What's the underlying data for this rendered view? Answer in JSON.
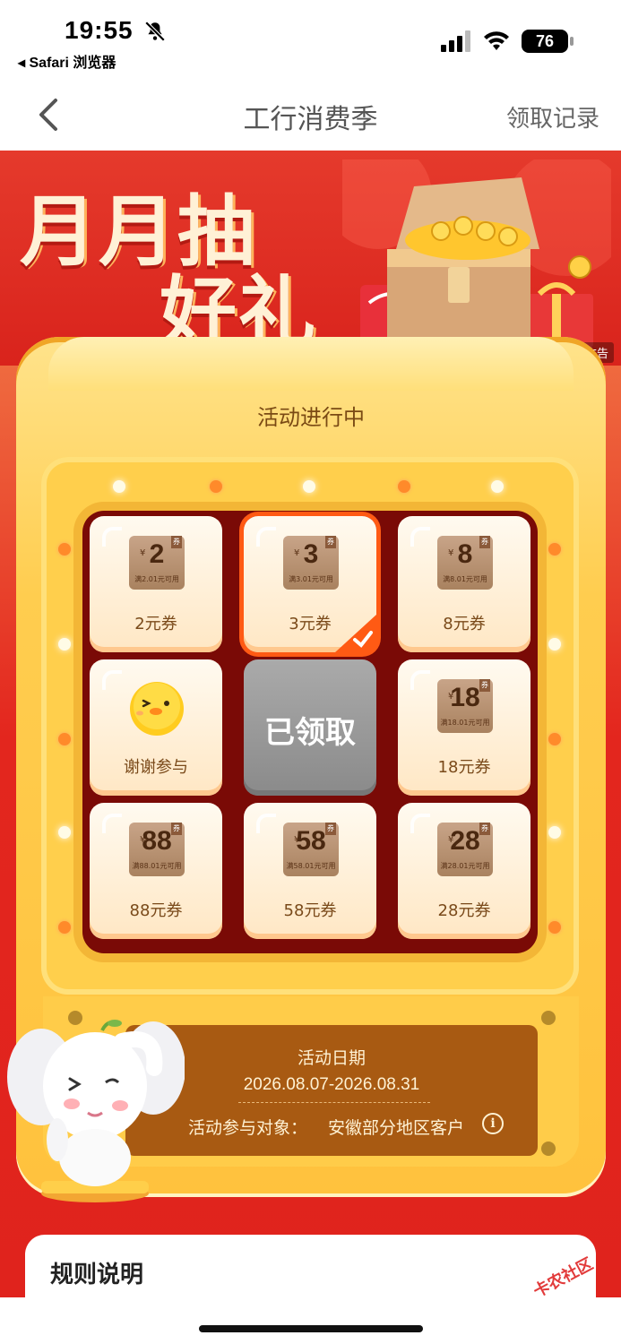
{
  "status_bar": {
    "time": "19:55",
    "back_app": "◂ Safari 浏览器",
    "battery": "76"
  },
  "nav": {
    "title": "工行消费季",
    "right_link": "领取记录"
  },
  "banner": {
    "line1": "月月抽",
    "line2": "好礼",
    "ad_tag": "广告"
  },
  "activity": {
    "status": "活动进行中"
  },
  "grid": {
    "cells": [
      {
        "amount": "2",
        "condition": "满2.01元可用",
        "label": "2元券"
      },
      {
        "amount": "3",
        "condition": "满3.01元可用",
        "label": "3元券"
      },
      {
        "amount": "8",
        "condition": "满8.01元可用",
        "label": "8元券"
      },
      {
        "label": "谢谢参与"
      },
      {
        "label": "已领取"
      },
      {
        "amount": "18",
        "condition": "满18.01元可用",
        "label": "18元券"
      },
      {
        "amount": "88",
        "condition": "满88.01元可用",
        "label": "88元券"
      },
      {
        "amount": "58",
        "condition": "满58.01元可用",
        "label": "58元券"
      },
      {
        "amount": "28",
        "condition": "满28.01元可用",
        "label": "28元券"
      }
    ],
    "coupon_tag": "券",
    "currency": "¥"
  },
  "info": {
    "title": "活动日期",
    "date_range": "2026.08.07-2026.08.31",
    "target_label": "活动参与对象：",
    "target_value": "安徽部分地区客户",
    "info_icon": "i"
  },
  "rules": {
    "title": "规则说明"
  },
  "watermark": "卡农社区",
  "colors": {
    "banner_red": "#e53a2c",
    "gold": "#ffc23d",
    "selected_border": "#ff5a14",
    "panel_brown": "#a85a12"
  }
}
